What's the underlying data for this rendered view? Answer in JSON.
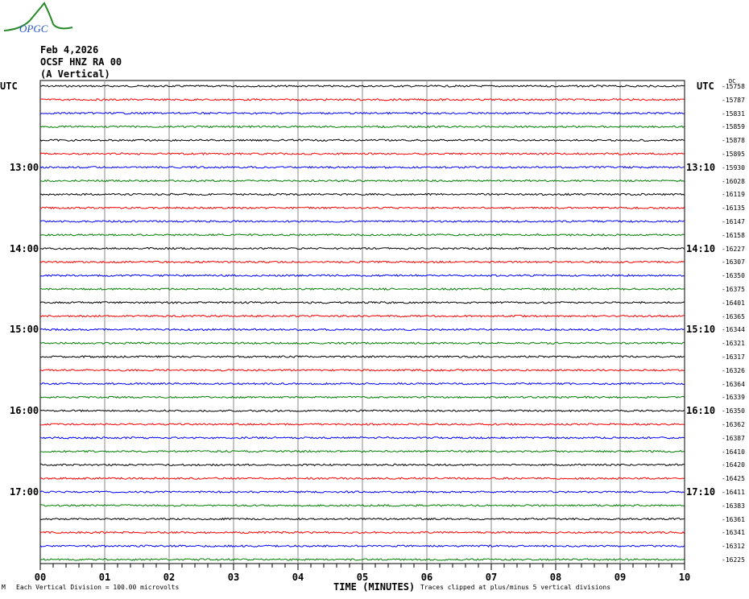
{
  "logo": {
    "text": "OPGC"
  },
  "header": {
    "date": "Feb 4,2026",
    "station": "OCSF HNZ RA 00",
    "component": "(A Vertical)"
  },
  "left_axis": {
    "title": "UTC",
    "labels": [
      {
        "trace": 6,
        "text": "13:00"
      },
      {
        "trace": 12,
        "text": "14:00"
      },
      {
        "trace": 18,
        "text": "15:00"
      },
      {
        "trace": 24,
        "text": "16:00"
      },
      {
        "trace": 30,
        "text": "17:00"
      }
    ]
  },
  "right_axis": {
    "title": "UTC",
    "dc_label": "DC",
    "labels": [
      {
        "trace": 6,
        "text": "13:10"
      },
      {
        "trace": 12,
        "text": "14:10"
      },
      {
        "trace": 18,
        "text": "15:10"
      },
      {
        "trace": 24,
        "text": "16:10"
      },
      {
        "trace": 30,
        "text": "17:10"
      }
    ]
  },
  "footer": {
    "marker": "M",
    "scale": "Each Vertical Division =  100.00 microvolts",
    "clip": "Traces clipped at plus/minus 5 vertical divisions"
  },
  "chart_data": {
    "type": "line",
    "title": "OCSF HNZ RA 00 (A Vertical) Feb 4,2026",
    "xlabel": "TIME (MINUTES)",
    "xlim": [
      0,
      10
    ],
    "xticks": [
      "00",
      "01",
      "02",
      "03",
      "04",
      "05",
      "06",
      "07",
      "08",
      "09",
      "10"
    ],
    "trace_colors": [
      "#000000",
      "#ff0000",
      "#0000ff",
      "#007f00"
    ],
    "trace_minutes": 10,
    "dc_offsets": [
      -15758,
      -15787,
      -15831,
      -15859,
      -15878,
      -15895,
      -15930,
      -16028,
      -16119,
      -16135,
      -16147,
      -16158,
      -16227,
      -16307,
      -16350,
      -16375,
      -16401,
      -16365,
      -16344,
      -16321,
      -16317,
      -16326,
      -16364,
      -16339,
      -16350,
      -16362,
      -16387,
      -16410,
      -16420,
      -16425,
      -16411,
      -16383,
      -16361,
      -16341,
      -16312,
      -16225
    ]
  }
}
